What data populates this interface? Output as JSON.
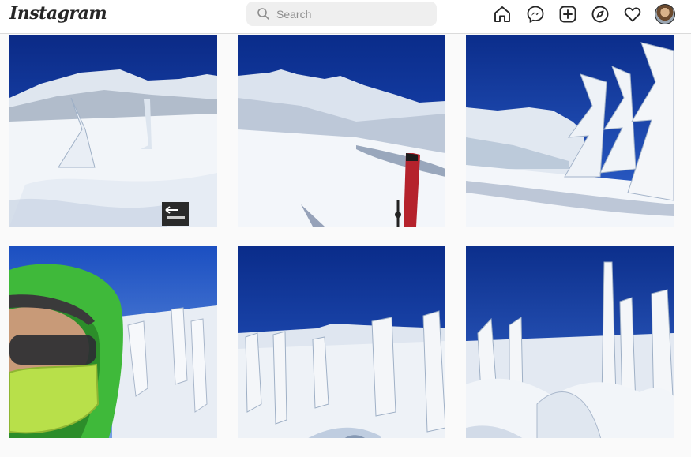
{
  "header": {
    "logo_text": "Instagram",
    "search": {
      "placeholder": "Search",
      "value": ""
    },
    "nav_icons": [
      "home-icon",
      "messenger-icon",
      "new-post-icon",
      "explore-icon",
      "activity-heart-icon",
      "profile-avatar"
    ]
  },
  "grid": {
    "posts": [
      {
        "scene": "snowy-mountain-with-trail-sign"
      },
      {
        "scene": "snow-slope-with-red-ski"
      },
      {
        "scene": "frosted-trees-snowy-ridge"
      },
      {
        "scene": "selfie-green-hood-snow"
      },
      {
        "scene": "snow-monster-trees-valley"
      },
      {
        "scene": "rime-covered-forest"
      }
    ]
  },
  "colors": {
    "sky_deep": "#0a2e8c",
    "sky": "#1f4fc6",
    "snow": "#f4f6f9",
    "shadow": "#b9c7dd",
    "jacket_green": "#3fb93a",
    "ski_red": "#b5222c",
    "text_dark": "#262626",
    "border": "#dbdbdb"
  }
}
